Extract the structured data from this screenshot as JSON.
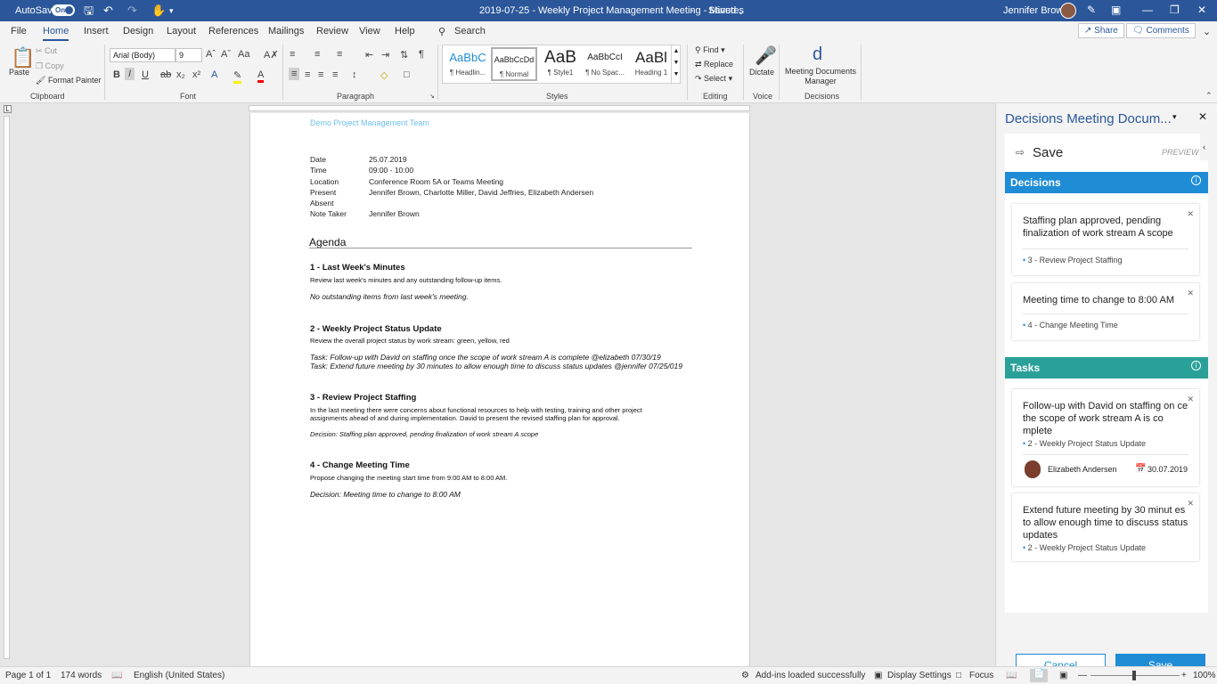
{
  "titlebar": {
    "autosave": "AutoSave",
    "autosave_state": "On",
    "doc_title": "2019-07-25 - Weekly Project Management Meeting - Minutes",
    "saved": "Saved",
    "user": "Jennifer Brown"
  },
  "tabs": [
    "File",
    "Home",
    "Insert",
    "Design",
    "Layout",
    "References",
    "Mailings",
    "Review",
    "View",
    "Help"
  ],
  "search": "Search",
  "share": "Share",
  "comments": "Comments",
  "ribbon": {
    "paste": "Paste",
    "cut": "Cut",
    "copy": "Copy",
    "format_painter": "Format Painter",
    "clipboard": "Clipboard",
    "font_name": "Arial (Body)",
    "font_size": "9",
    "font": "Font",
    "paragraph": "Paragraph",
    "styles_label": "Styles",
    "styles": [
      {
        "sample": "AaBbC",
        "label": "¶ Headlin..."
      },
      {
        "sample": "AaBbCcDd",
        "label": "¶ Normal"
      },
      {
        "sample": "AaB",
        "label": "¶ Style1"
      },
      {
        "sample": "AaBbCcI",
        "label": "¶ No Spac..."
      },
      {
        "sample": "AaBl",
        "label": "Heading 1"
      }
    ],
    "find": "Find",
    "replace": "Replace",
    "select": "Select",
    "editing": "Editing",
    "dictate": "Dictate",
    "voice": "Voice",
    "mdm": "Meeting Documents Manager",
    "decisions": "Decisions"
  },
  "document": {
    "team": "Demo Project Management Team",
    "meta": [
      {
        "label": "Date",
        "value": "25.07.2019"
      },
      {
        "label": "Time",
        "value": "09:00 - 10:00"
      },
      {
        "label": "Location",
        "value": "Conference Room 5A or Teams Meeting"
      },
      {
        "label": "Present",
        "value": "Jennifer Brown, Charlotte Miller, David Jeffries, Elizabeth Andersen"
      },
      {
        "label": "Absent",
        "value": ""
      },
      {
        "label": "Note Taker",
        "value": "Jennifer Brown"
      }
    ],
    "agenda": "Agenda",
    "s1_h": "1 - Last Week's Minutes",
    "s1_p": "Review last week's minutes and any outstanding follow-up items.",
    "s1_i": "No outstanding items from last week's meeting.",
    "s2_h": "2 - Weekly Project Status Update",
    "s2_p": "Review the overall project status by work stream: green, yellow, red",
    "s2_t1": "Task: Follow-up with David on staffing once the scope of work stream A is complete @elizabeth 07/30/19",
    "s2_t2": "Task: Extend future meeting by 30 minutes to allow enough time to discuss status updates @jennifer 07/25/019",
    "s3_h": "3 - Review Project Staffing",
    "s3_p1": "In the last meeting there were concerns about functional resources to help with testing, training and other project",
    "s3_p2": "assignments ahead of and during implementation. David to present the revised staffing plan for approval.",
    "s3_d": "Decision: Staffing plan approved, pending finalization of work stream A scope",
    "s4_h": "4 - Change Meeting Time",
    "s4_p": "Propose changing the meeting start time from 9:00 AM to 8:00 AM.",
    "s4_d": "Decision: Meeting time to change to 8:00 AM"
  },
  "pane": {
    "title": "Decisions Meeting Docum...",
    "save": "Save",
    "preview": "PREVIEW",
    "decisions_h": "Decisions",
    "decisions": [
      {
        "text": "Staffing plan approved, pending finalization of work stream A scope",
        "ref": "3 - Review Project Staffing"
      },
      {
        "text": "Meeting time to change to 8:00 AM",
        "ref": "4 - Change Meeting Time"
      }
    ],
    "tasks_h": "Tasks",
    "tasks": [
      {
        "text": "Follow-up with David on staffing on ce the scope of work stream A is co mplete",
        "ref": "2 - Weekly Project Status Update",
        "assignee": "Elizabeth Andersen",
        "date": "30.07.2019"
      },
      {
        "text": "Extend future meeting by 30 minut es to allow enough time to discuss status updates",
        "ref": "2 - Weekly Project Status Update"
      }
    ],
    "cancel": "Cancel",
    "save_btn": "Save",
    "colors": {
      "decisions": "#1f8dd6",
      "tasks": "#2aa198"
    }
  },
  "status": {
    "page": "Page 1 of 1",
    "words": "174 words",
    "lang": "English (United States)",
    "addins": "Add-ins loaded successfully",
    "display": "Display Settings",
    "focus": "Focus",
    "zoom": "100%"
  }
}
